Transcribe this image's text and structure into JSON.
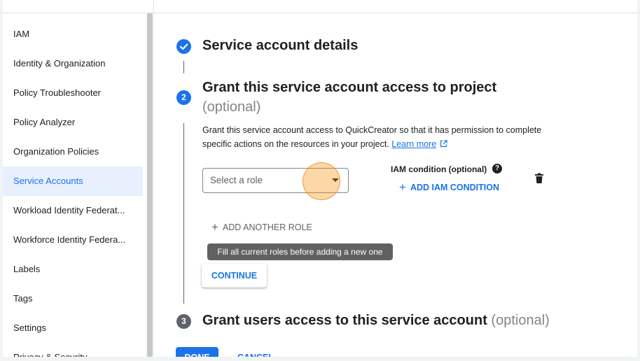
{
  "sidebar": {
    "items": [
      {
        "label": "IAM"
      },
      {
        "label": "Identity & Organization"
      },
      {
        "label": "Policy Troubleshooter"
      },
      {
        "label": "Policy Analyzer"
      },
      {
        "label": "Organization Policies"
      },
      {
        "label": "Service Accounts",
        "active": true
      },
      {
        "label": "Workload Identity Federat..."
      },
      {
        "label": "Workforce Identity Federa..."
      },
      {
        "label": "Labels"
      },
      {
        "label": "Tags"
      },
      {
        "label": "Settings"
      },
      {
        "label": "Privacy & Security"
      }
    ]
  },
  "steps": {
    "step1": {
      "title": "Service account details",
      "icon": "check-icon"
    },
    "step2": {
      "number": "2",
      "title": "Grant this service account access to project",
      "optional": "(optional)",
      "description": "Grant this service account access to QuickCreator so that it has permission to complete specific actions on the resources in your project.",
      "learn_more": "Learn more"
    },
    "step3": {
      "number": "3",
      "title": "Grant users access to this service account",
      "optional": "(optional)"
    }
  },
  "role_form": {
    "select_placeholder": "Select a role",
    "condition_label": "IAM condition (optional)",
    "add_condition": "ADD IAM CONDITION",
    "add_another_role": "ADD ANOTHER ROLE",
    "tooltip": "Fill all current roles before adding a new one",
    "continue": "CONTINUE"
  },
  "actions": {
    "done": "DONE",
    "cancel": "CANCEL"
  },
  "colors": {
    "accent": "#1a73e8",
    "active_bg": "#e8f0fe",
    "step_inactive": "#5f6368",
    "click_highlight": "#fb8c00"
  }
}
